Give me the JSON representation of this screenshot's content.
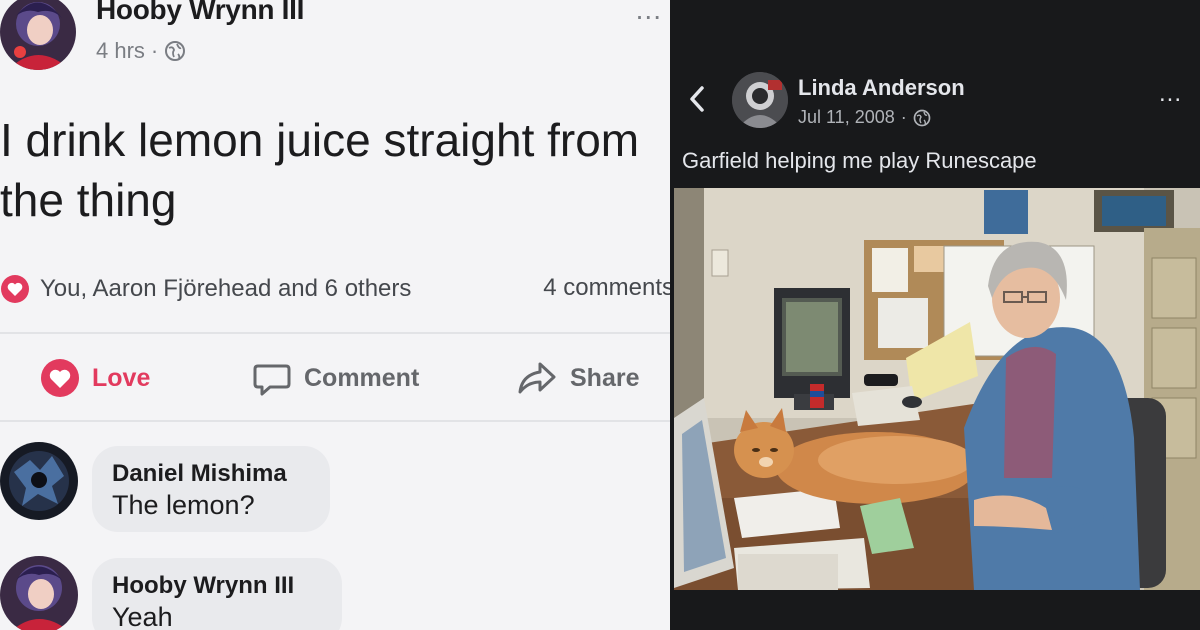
{
  "left_post": {
    "author": "Hooby Wrynn III",
    "time": "4 hrs",
    "separator": "·",
    "more": "...",
    "text": "I drink lemon juice straight from\nthe thing",
    "reactions_text": "You, Aaron Fjörehead and 6 others",
    "comments_count": "4 comments",
    "actions": {
      "love": "Love",
      "comment": "Comment",
      "share": "Share"
    },
    "comments": [
      {
        "name": "Daniel Mishima",
        "text": "The lemon?"
      },
      {
        "name": "Hooby Wrynn III",
        "text": "Yeah"
      }
    ],
    "icons": {
      "globe": "globe-icon",
      "heart": "heart-icon",
      "comment": "comment-bubble-icon",
      "share": "share-arrow-icon"
    },
    "colors": {
      "love": "#e23a5e",
      "background": "#f4f4f6"
    }
  },
  "right_post": {
    "author": "Linda Anderson",
    "date": "Jul 11, 2008",
    "separator": "·",
    "more": "...",
    "text": "Garfield helping me play Runescape",
    "icons": {
      "back": "chevron-left-icon",
      "globe": "globe-icon"
    },
    "colors": {
      "background": "#18191b",
      "text": "#e4e6eb",
      "muted": "#b0b3b8"
    }
  }
}
